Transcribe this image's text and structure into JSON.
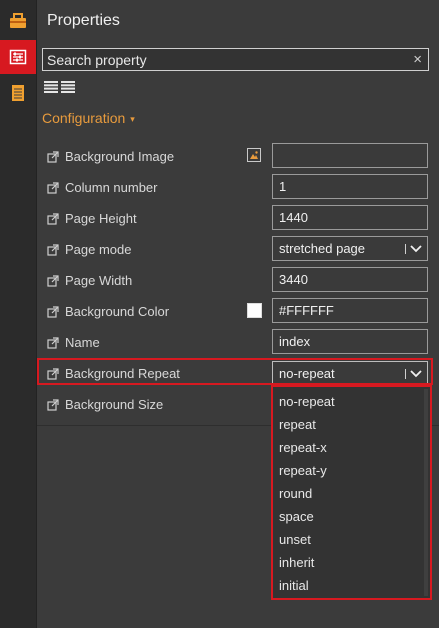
{
  "panel": {
    "title": "Properties",
    "search_placeholder": "Search property",
    "clear_glyph": "×"
  },
  "section": {
    "label": "Configuration",
    "caret": "▾"
  },
  "properties": [
    {
      "label": "Background Image",
      "value": ""
    },
    {
      "label": "Column number",
      "value": "1"
    },
    {
      "label": "Page Height",
      "value": "1440"
    },
    {
      "label": "Page mode",
      "value": "stretched page"
    },
    {
      "label": "Page Width",
      "value": "3440"
    },
    {
      "label": "Background Color",
      "value": "#FFFFFF"
    },
    {
      "label": "Name",
      "value": "index"
    },
    {
      "label": "Background Repeat",
      "value": "no-repeat"
    },
    {
      "label": "Background Size",
      "value": ""
    }
  ],
  "repeat_options": [
    "no-repeat",
    "repeat",
    "repeat-x",
    "repeat-y",
    "round",
    "space",
    "unset",
    "inherit",
    "initial"
  ],
  "colors": {
    "accent_red": "#d71920",
    "section_orange": "#e89b3d",
    "background_color_value": "#FFFFFF"
  },
  "icons": [
    "toolbox-icon",
    "properties-icon",
    "page-list-icon",
    "external-link-icon",
    "image-icon",
    "chevron-down-icon",
    "list-view-icon",
    "detail-view-icon",
    "clear-icon"
  ]
}
